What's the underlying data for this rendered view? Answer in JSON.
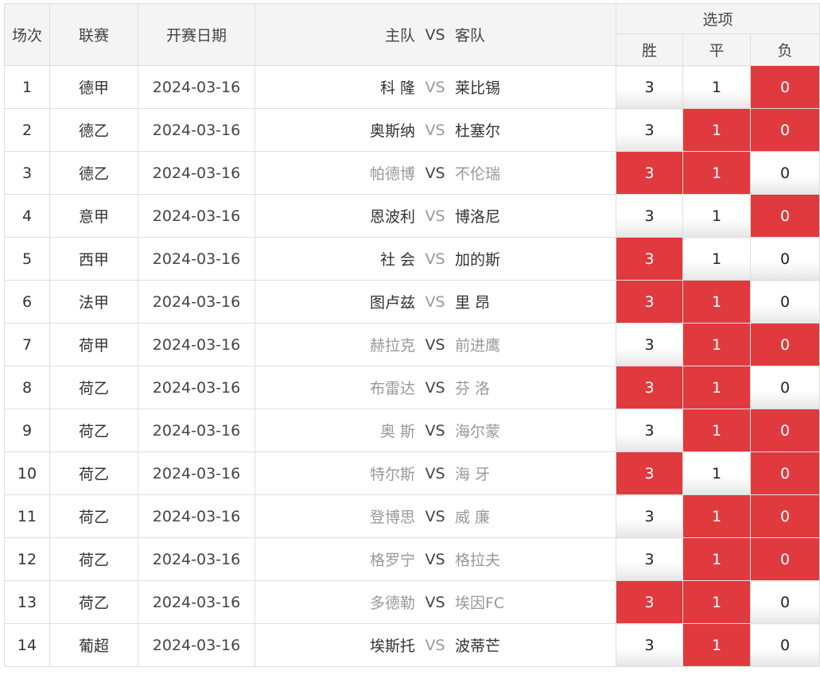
{
  "header": {
    "changci": "场次",
    "liansai": "联赛",
    "date": "开赛日期",
    "home": "主队",
    "vs": "VS",
    "away": "客队",
    "options": "选项",
    "win": "胜",
    "draw": "平",
    "lose": "负"
  },
  "colors": {
    "selected": "#e03a3e",
    "border": "#dedede",
    "header_bg": "#f4f4f4"
  },
  "rows": [
    {
      "no": "1",
      "league": "德甲",
      "date": "2024-03-16",
      "home": "科 隆",
      "vs": "VS",
      "away": "莱比锡",
      "dim": false,
      "odds": [
        "3",
        "1",
        "0"
      ],
      "selected": [
        false,
        false,
        true
      ]
    },
    {
      "no": "2",
      "league": "德乙",
      "date": "2024-03-16",
      "home": "奥斯纳",
      "vs": "VS",
      "away": "杜塞尔",
      "dim": false,
      "odds": [
        "3",
        "1",
        "0"
      ],
      "selected": [
        false,
        true,
        true
      ]
    },
    {
      "no": "3",
      "league": "德乙",
      "date": "2024-03-16",
      "home": "帕德博",
      "vs": "VS",
      "away": "不伦瑞",
      "dim": true,
      "odds": [
        "3",
        "1",
        "0"
      ],
      "selected": [
        true,
        true,
        false
      ]
    },
    {
      "no": "4",
      "league": "意甲",
      "date": "2024-03-16",
      "home": "恩波利",
      "vs": "VS",
      "away": "博洛尼",
      "dim": false,
      "odds": [
        "3",
        "1",
        "0"
      ],
      "selected": [
        false,
        false,
        true
      ]
    },
    {
      "no": "5",
      "league": "西甲",
      "date": "2024-03-16",
      "home": "社 会",
      "vs": "VS",
      "away": "加的斯",
      "dim": false,
      "odds": [
        "3",
        "1",
        "0"
      ],
      "selected": [
        true,
        false,
        false
      ]
    },
    {
      "no": "6",
      "league": "法甲",
      "date": "2024-03-16",
      "home": "图卢兹",
      "vs": "VS",
      "away": "里 昂",
      "dim": false,
      "odds": [
        "3",
        "1",
        "0"
      ],
      "selected": [
        true,
        true,
        false
      ]
    },
    {
      "no": "7",
      "league": "荷甲",
      "date": "2024-03-16",
      "home": "赫拉克",
      "vs": "VS",
      "away": "前进鹰",
      "dim": true,
      "odds": [
        "3",
        "1",
        "0"
      ],
      "selected": [
        false,
        true,
        true
      ]
    },
    {
      "no": "8",
      "league": "荷乙",
      "date": "2024-03-16",
      "home": "布雷达",
      "vs": "VS",
      "away": "芬 洛",
      "dim": true,
      "odds": [
        "3",
        "1",
        "0"
      ],
      "selected": [
        true,
        true,
        false
      ]
    },
    {
      "no": "9",
      "league": "荷乙",
      "date": "2024-03-16",
      "home": "奥 斯",
      "vs": "VS",
      "away": "海尔蒙",
      "dim": true,
      "odds": [
        "3",
        "1",
        "0"
      ],
      "selected": [
        false,
        true,
        true
      ]
    },
    {
      "no": "10",
      "league": "荷乙",
      "date": "2024-03-16",
      "home": "特尔斯",
      "vs": "VS",
      "away": "海 牙",
      "dim": true,
      "odds": [
        "3",
        "1",
        "0"
      ],
      "selected": [
        true,
        false,
        true
      ]
    },
    {
      "no": "11",
      "league": "荷乙",
      "date": "2024-03-16",
      "home": "登博思",
      "vs": "VS",
      "away": "威 廉",
      "dim": true,
      "odds": [
        "3",
        "1",
        "0"
      ],
      "selected": [
        false,
        true,
        true
      ]
    },
    {
      "no": "12",
      "league": "荷乙",
      "date": "2024-03-16",
      "home": "格罗宁",
      "vs": "VS",
      "away": "格拉夫",
      "dim": true,
      "odds": [
        "3",
        "1",
        "0"
      ],
      "selected": [
        false,
        true,
        true
      ]
    },
    {
      "no": "13",
      "league": "荷乙",
      "date": "2024-03-16",
      "home": "多德勒",
      "vs": "VS",
      "away": "埃因FC",
      "dim": true,
      "odds": [
        "3",
        "1",
        "0"
      ],
      "selected": [
        true,
        true,
        false
      ]
    },
    {
      "no": "14",
      "league": "葡超",
      "date": "2024-03-16",
      "home": "埃斯托",
      "vs": "VS",
      "away": "波蒂芒",
      "dim": false,
      "odds": [
        "3",
        "1",
        "0"
      ],
      "selected": [
        false,
        true,
        false
      ]
    }
  ]
}
